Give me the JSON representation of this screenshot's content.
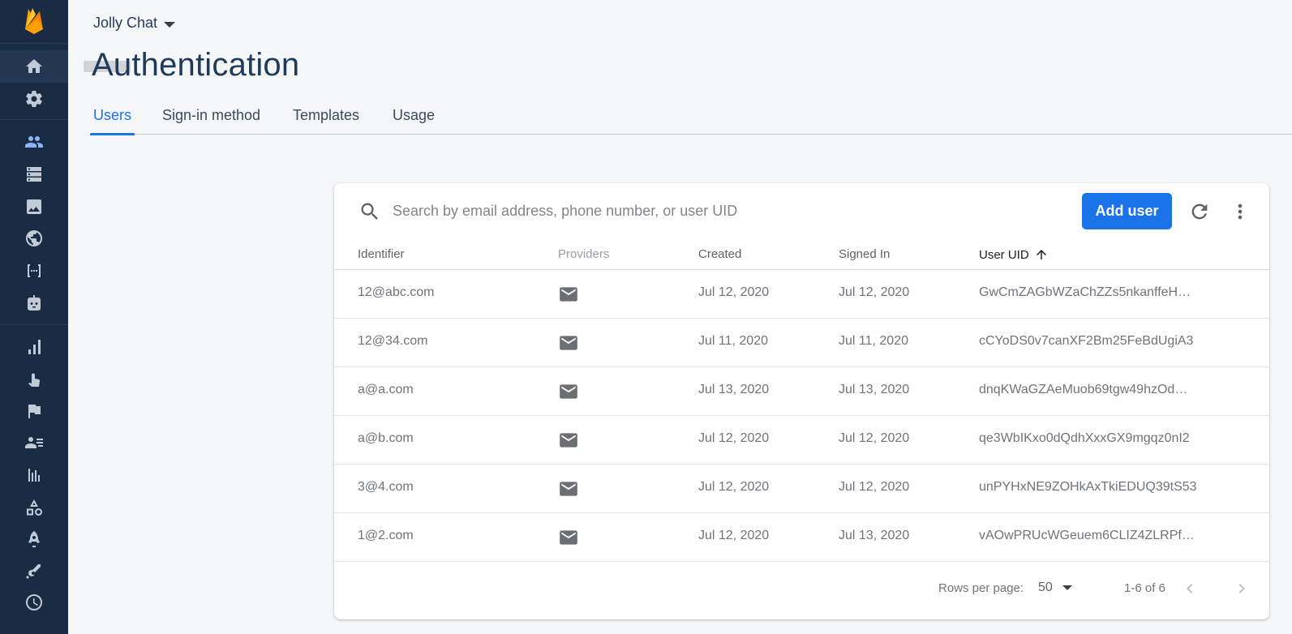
{
  "project": {
    "name": "Jolly Chat"
  },
  "page": {
    "title": "Authentication"
  },
  "tabs": [
    {
      "label": "Users",
      "active": true
    },
    {
      "label": "Sign-in method",
      "active": false
    },
    {
      "label": "Templates",
      "active": false
    },
    {
      "label": "Usage",
      "active": false
    }
  ],
  "search": {
    "placeholder": "Search by email address, phone number, or user UID"
  },
  "toolbar": {
    "add_user_label": "Add user"
  },
  "table": {
    "headers": {
      "identifier": "Identifier",
      "providers": "Providers",
      "created": "Created",
      "signed_in": "Signed In",
      "user_uid": "User UID"
    },
    "rows": [
      {
        "identifier": "12@abc.com",
        "provider": "mail-icon",
        "created": "Jul 12, 2020",
        "signed_in": "Jul 12, 2020",
        "user_uid": "GwCmZAGbWZaChZZs5nkanffeH…"
      },
      {
        "identifier": "12@34.com",
        "provider": "mail-icon",
        "created": "Jul 11, 2020",
        "signed_in": "Jul 11, 2020",
        "user_uid": "cCYoDS0v7canXF2Bm25FeBdUgiA3"
      },
      {
        "identifier": "a@a.com",
        "provider": "mail-icon",
        "created": "Jul 13, 2020",
        "signed_in": "Jul 13, 2020",
        "user_uid": "dnqKWaGZAeMuob69tgw49hzOd…"
      },
      {
        "identifier": "a@b.com",
        "provider": "mail-icon",
        "created": "Jul 12, 2020",
        "signed_in": "Jul 12, 2020",
        "user_uid": "qe3WbIKxo0dQdhXxxGX9mgqz0nI2"
      },
      {
        "identifier": "3@4.com",
        "provider": "mail-icon",
        "created": "Jul 12, 2020",
        "signed_in": "Jul 12, 2020",
        "user_uid": "unPYHxNE9ZOHkAxTkiEDUQ39tS53"
      },
      {
        "identifier": "1@2.com",
        "provider": "mail-icon",
        "created": "Jul 12, 2020",
        "signed_in": "Jul 13, 2020",
        "user_uid": "vAOwPRUcWGeuem6CLIZ4ZLRPf…"
      }
    ]
  },
  "pagination": {
    "rows_per_page_label": "Rows per page:",
    "rows_per_page": "50",
    "range": "1-6 of 6"
  },
  "colors": {
    "sidebar": "#1a2b44",
    "accent": "#1a73e8",
    "title": "#1f3b5a",
    "background": "#f5f6f8"
  },
  "sidebar_icons": [
    "home-icon",
    "gear-icon",
    "users-icon",
    "database-icon",
    "storage-icon",
    "hosting-icon",
    "functions-icon",
    "ml-icon",
    "analytics-icon",
    "predictions-icon",
    "ab-testing-icon",
    "audiences-icon",
    "extensions-icon",
    "app-distribution-icon",
    "crashlytics-icon",
    "performance-icon",
    "remote-config-icon"
  ]
}
